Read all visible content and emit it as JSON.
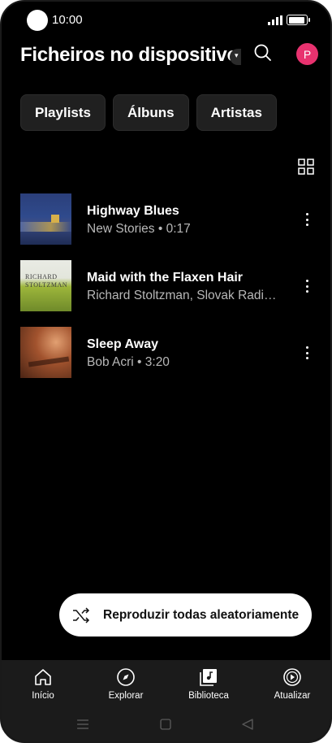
{
  "status": {
    "time": "10:00"
  },
  "header": {
    "title": "Ficheiros no dispositivo",
    "avatar_letter": "P"
  },
  "chips": [
    "Playlists",
    "Álbuns",
    "Artistas"
  ],
  "songs": [
    {
      "title": "Highway Blues",
      "subtitle": "New Stories • 0:17"
    },
    {
      "title": "Maid with the Flaxen Hair",
      "subtitle": "Richard Stoltzman, Slovak Radio …",
      "art_text": "RICHARD\nSTOLTZMAN"
    },
    {
      "title": "Sleep Away",
      "subtitle": "Bob Acri • 3:20"
    }
  ],
  "shuffle": {
    "label": "Reproduzir todas aleatoriamente"
  },
  "nav": [
    {
      "label": "Início",
      "icon": "home-icon"
    },
    {
      "label": "Explorar",
      "icon": "compass-icon"
    },
    {
      "label": "Biblioteca",
      "icon": "library-icon"
    },
    {
      "label": "Atualizar",
      "icon": "play-circle-icon"
    }
  ],
  "colors": {
    "accent_avatar": "#e8326f",
    "background": "#000000",
    "nav_background": "#1b1b1b"
  }
}
